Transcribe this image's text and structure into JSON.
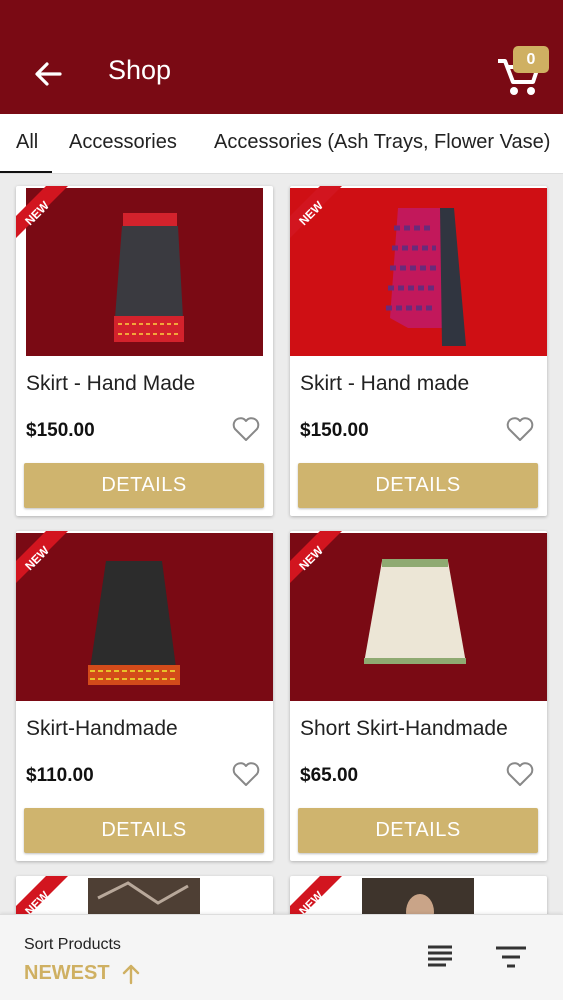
{
  "appbar": {
    "title": "Shop",
    "cart_count": "0"
  },
  "tabs": [
    {
      "label": "All",
      "active": true
    },
    {
      "label": "Accessories",
      "active": false
    },
    {
      "label": "Accessories (Ash Trays, Flower Vase)",
      "active": false
    }
  ],
  "products": [
    {
      "name": "Skirt - Hand Made",
      "price": "$150.00",
      "badge": "NEW",
      "button": "DETAILS"
    },
    {
      "name": "Skirt - Hand made",
      "price": "$150.00",
      "badge": "NEW",
      "button": "DETAILS"
    },
    {
      "name": "Skirt-Handmade",
      "price": "$110.00",
      "badge": "NEW",
      "button": "DETAILS"
    },
    {
      "name": "Short Skirt-Handmade",
      "price": "$65.00",
      "badge": "NEW",
      "button": "DETAILS"
    },
    {
      "badge": "NEW"
    },
    {
      "badge": "NEW"
    }
  ],
  "bottombar": {
    "sort_label": "Sort Products",
    "sort_value": "NEWEST"
  },
  "colors": {
    "primary": "#7a0a14",
    "accent": "#cfb062",
    "badge": "#d2151f"
  },
  "icons": {
    "back": "arrow-left-icon",
    "cart": "shopping-cart-icon",
    "heart": "heart-outline-icon",
    "sort_direction": "arrow-up-icon",
    "view": "list-view-icon",
    "filter": "filter-icon"
  }
}
